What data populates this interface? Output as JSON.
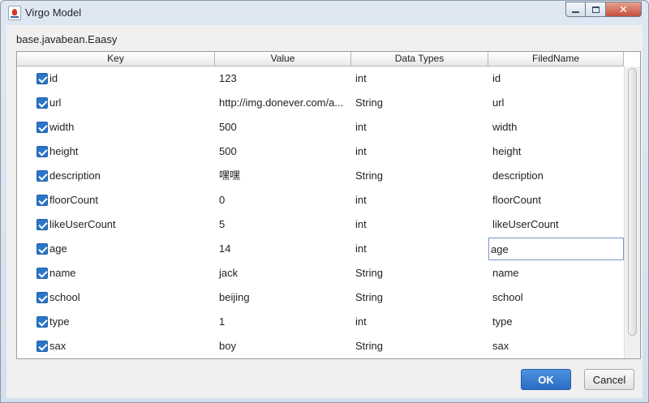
{
  "window": {
    "title": "Virgo Model"
  },
  "class_path": "base.javabean.Eaasy",
  "table": {
    "columns": [
      "Key",
      "Value",
      "Data Types",
      "FiledName"
    ],
    "rows": [
      {
        "checked": true,
        "key": "id",
        "value": "123",
        "type": "int",
        "field": "id"
      },
      {
        "checked": true,
        "key": "url",
        "value": "http://img.donever.com/a...",
        "type": "String",
        "field": "url"
      },
      {
        "checked": true,
        "key": "width",
        "value": "500",
        "type": "int",
        "field": "width"
      },
      {
        "checked": true,
        "key": "height",
        "value": "500",
        "type": "int",
        "field": "height"
      },
      {
        "checked": true,
        "key": "description",
        "value": "嘿嘿",
        "type": "String",
        "field": "description"
      },
      {
        "checked": true,
        "key": "floorCount",
        "value": "0",
        "type": "int",
        "field": "floorCount"
      },
      {
        "checked": true,
        "key": "likeUserCount",
        "value": "5",
        "type": "int",
        "field": "likeUserCount"
      },
      {
        "checked": true,
        "key": "age",
        "value": "14",
        "type": "int",
        "field": "age",
        "editing": true
      },
      {
        "checked": true,
        "key": "name",
        "value": "jack",
        "type": "String",
        "field": "name"
      },
      {
        "checked": true,
        "key": "school",
        "value": "beijing",
        "type": "String",
        "field": "school"
      },
      {
        "checked": true,
        "key": "type",
        "value": "1",
        "type": "int",
        "field": "type"
      },
      {
        "checked": true,
        "key": "sax",
        "value": "boy",
        "type": "String",
        "field": "sax"
      }
    ]
  },
  "buttons": {
    "ok": "OK",
    "cancel": "Cancel"
  },
  "icons": {
    "app": "java-cup-icon",
    "minimize": "minimize-icon",
    "maximize": "maximize-icon",
    "close": "close-icon",
    "checkbox": "checkbox-checked-icon"
  },
  "colors": {
    "accent": "#2b76c9",
    "close": "#c4513b"
  }
}
